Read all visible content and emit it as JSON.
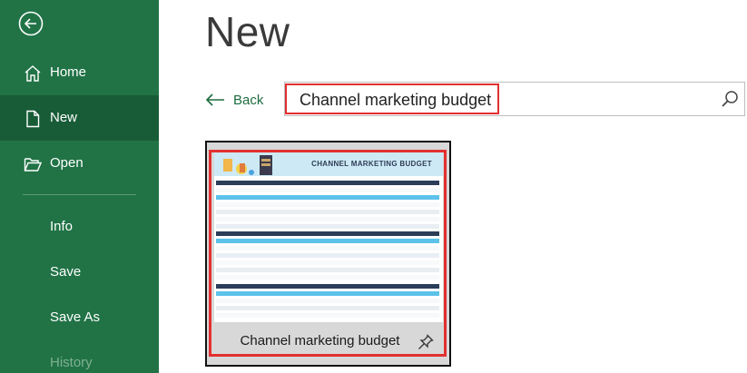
{
  "sidebar": {
    "back_icon": "back-arrow-circle-icon",
    "items": [
      {
        "label": "Home",
        "icon": "home-icon"
      },
      {
        "label": "New",
        "icon": "new-document-icon",
        "selected": true
      },
      {
        "label": "Open",
        "icon": "open-folder-icon"
      },
      {
        "label": "Info"
      },
      {
        "label": "Save"
      },
      {
        "label": "Save As"
      },
      {
        "label": "History"
      }
    ],
    "colors": {
      "background": "#217346",
      "selected": "#185c37"
    }
  },
  "main": {
    "title": "New",
    "back_label": "Back",
    "search": {
      "value": "Channel marketing budget",
      "icon": "search-icon"
    },
    "templates": [
      {
        "name": "Channel marketing budget",
        "thumbnail_title": "CHANNEL MARKETING BUDGET",
        "pin_icon": "pin-icon"
      }
    ]
  },
  "colors": {
    "accent": "#1e6b3f",
    "highlight": "#e23030"
  }
}
